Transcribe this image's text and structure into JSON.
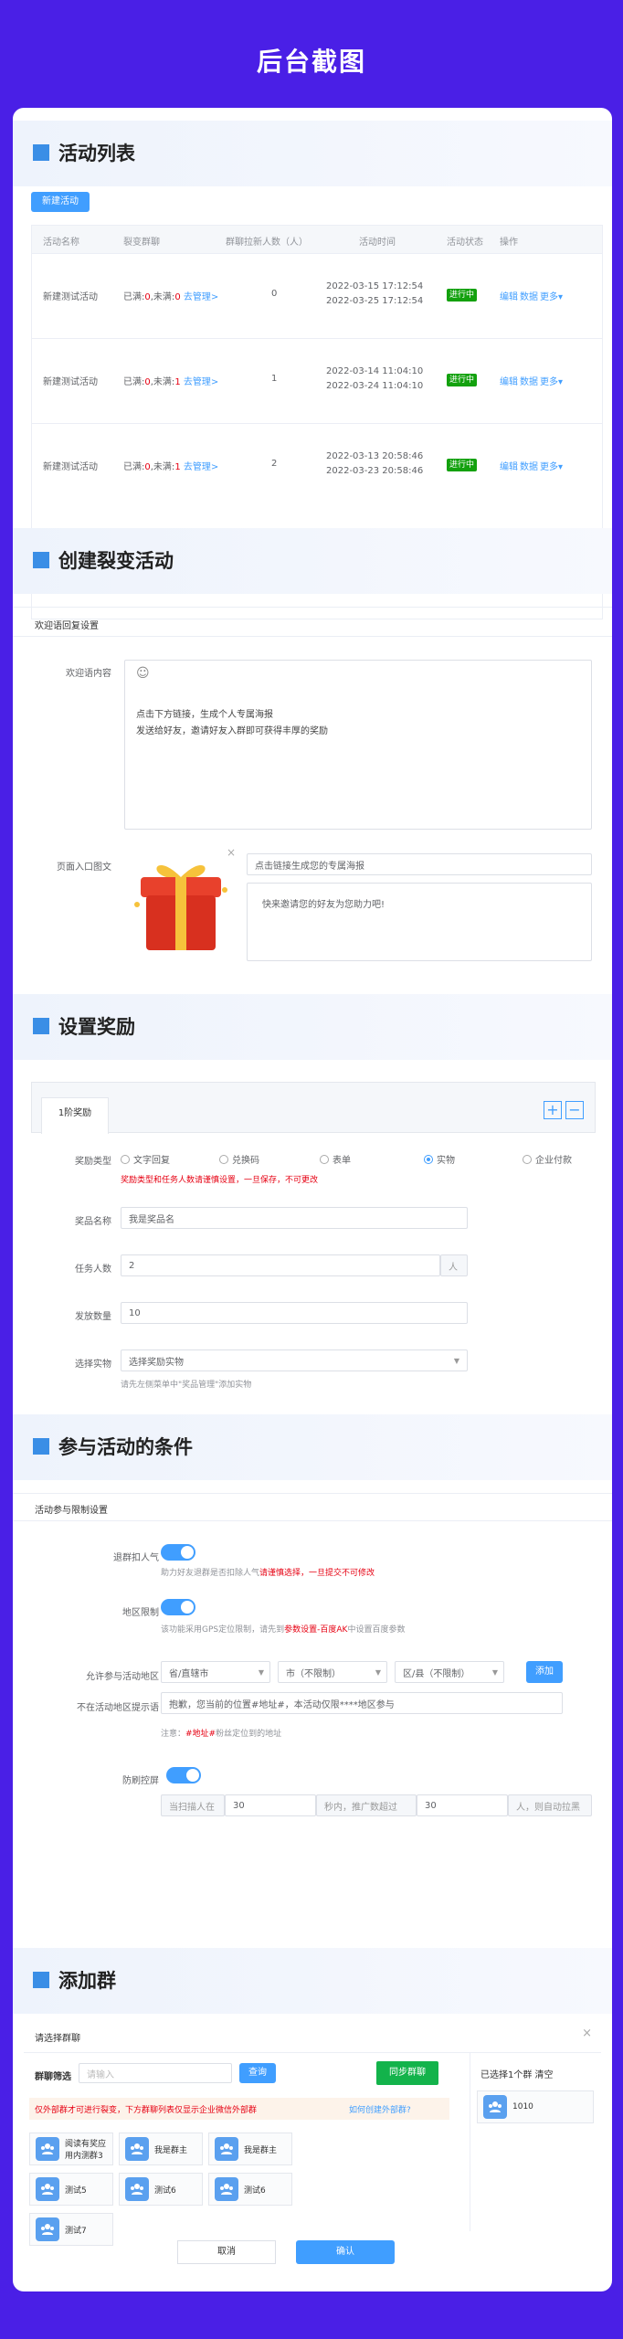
{
  "page_title": "后台截图",
  "sections": {
    "list": "活动列表",
    "create": "创建裂变活动",
    "reward": "设置奖励",
    "conditions": "参与活动的条件",
    "groups": "添加群"
  },
  "activity_list": {
    "new_button": "新建活动",
    "columns": [
      "活动名称",
      "裂变群聊",
      "群聊拉新人数（人）",
      "活动时间",
      "活动状态",
      "操作"
    ],
    "rows": [
      {
        "name": "新建测试活动",
        "group_prefix": "已满:",
        "full": "0",
        "mid": ",未满:",
        "not_full": "0",
        "manage": "去管理>",
        "count": "0",
        "start": "2022-03-15 17:12:54",
        "end": "2022-03-25 17:12:54",
        "status": "进行中",
        "edit": "编辑",
        "data": "数据",
        "more": "更多▾"
      },
      {
        "name": "新建测试活动",
        "group_prefix": "已满:",
        "full": "0",
        "mid": ",未满:",
        "not_full": "1",
        "manage": "去管理>",
        "count": "1",
        "start": "2022-03-14 11:04:10",
        "end": "2022-03-24 11:04:10",
        "status": "进行中",
        "edit": "编辑",
        "data": "数据",
        "more": "更多▾"
      },
      {
        "name": "新建测试活动",
        "group_prefix": "已满:",
        "full": "0",
        "mid": ",未满:",
        "not_full": "1",
        "manage": "去管理>",
        "count": "2",
        "start": "2022-03-13 20:58:46",
        "end": "2022-03-23 20:58:46",
        "status": "进行中",
        "edit": "编辑",
        "data": "数据",
        "more": "更多▾"
      }
    ]
  },
  "create": {
    "subhead": "欢迎语回复设置",
    "welcome_label": "欢迎语内容",
    "welcome_emoji": "☺",
    "welcome_line1": "点击下方链接，生成个人专属海报",
    "welcome_line2": "发送给好友，邀请好友入群即可获得丰厚的奖励",
    "entry_label": "页面入口图文",
    "entry_title": "点击链接生成您的专属海报",
    "entry_desc": "快来邀请您的好友为您助力吧!",
    "close": "×"
  },
  "reward": {
    "tab": "1阶奖励",
    "plus": "+",
    "minus": "−",
    "type_label": "奖励类型",
    "types": [
      "文字回复",
      "兑换码",
      "表单",
      "实物",
      "企业付款"
    ],
    "selected_type": "实物",
    "type_warning": "奖励类型和任务人数请谨慎设置，一旦保存，不可更改",
    "name_label": "奖品名称",
    "name_value": "我是奖品名",
    "task_label": "任务人数",
    "task_value": "2",
    "task_unit": "人",
    "qty_label": "发放数量",
    "qty_value": "10",
    "item_label": "选择实物",
    "item_placeholder": "选择奖励实物",
    "item_hint": "请先左侧菜单中\"奖品管理\"添加实物"
  },
  "conditions": {
    "subhead": "活动参与限制设置",
    "quit_label": "退群扣人气",
    "quit_hint_a": "助力好友退群是否扣除人气",
    "quit_hint_b": "请谨慎选择，一旦提交不可修改",
    "region_label": "地区限制",
    "region_hint_a": "该功能采用GPS定位限制，请先到",
    "region_hint_b": "参数设置-百度AK",
    "region_hint_c": "中设置百度参数",
    "allowed_label": "允许参与活动地区",
    "province": "省/直辖市",
    "city": "市（不限制）",
    "district": "区/县（不限制）",
    "add": "添加",
    "outside_label": "不在活动地区提示语",
    "outside_value": "抱歉，您当前的位置#地址#，本活动仅限****地区参与",
    "note_a": "注意：",
    "note_b": "#地址#",
    "note_c": "粉丝定位到的地址",
    "anti_label": "防刷控屏",
    "anti_a": "当扫描人在",
    "anti_v1": "30",
    "anti_b": "秒内，推广数超过",
    "anti_v2": "30",
    "anti_c": "人，则自动拉黑"
  },
  "groups": {
    "dialog_title": "请选择群聊",
    "close": "×",
    "filter_label": "群聊筛选",
    "search_placeholder": "请输入",
    "search_btn": "查询",
    "sync_btn": "同步群聊",
    "notice": "仅外部群才可进行裂变，下方群聊列表仅显示企业微信外部群",
    "notice_link": "如何创建外部群?",
    "selected_head": "已选择1个群 清空",
    "selected": [
      "1010"
    ],
    "tiles": [
      "阅读有奖应用内测群3",
      "我是群主",
      "我是群主",
      "测试5",
      "测试6",
      "测试6",
      "测试7"
    ],
    "cancel": "取消",
    "confirm": "确认"
  },
  "colors": {
    "accent": "#409eff",
    "bg": "#4a1fe6",
    "status": "#13a10e",
    "warn": "#e60012"
  }
}
